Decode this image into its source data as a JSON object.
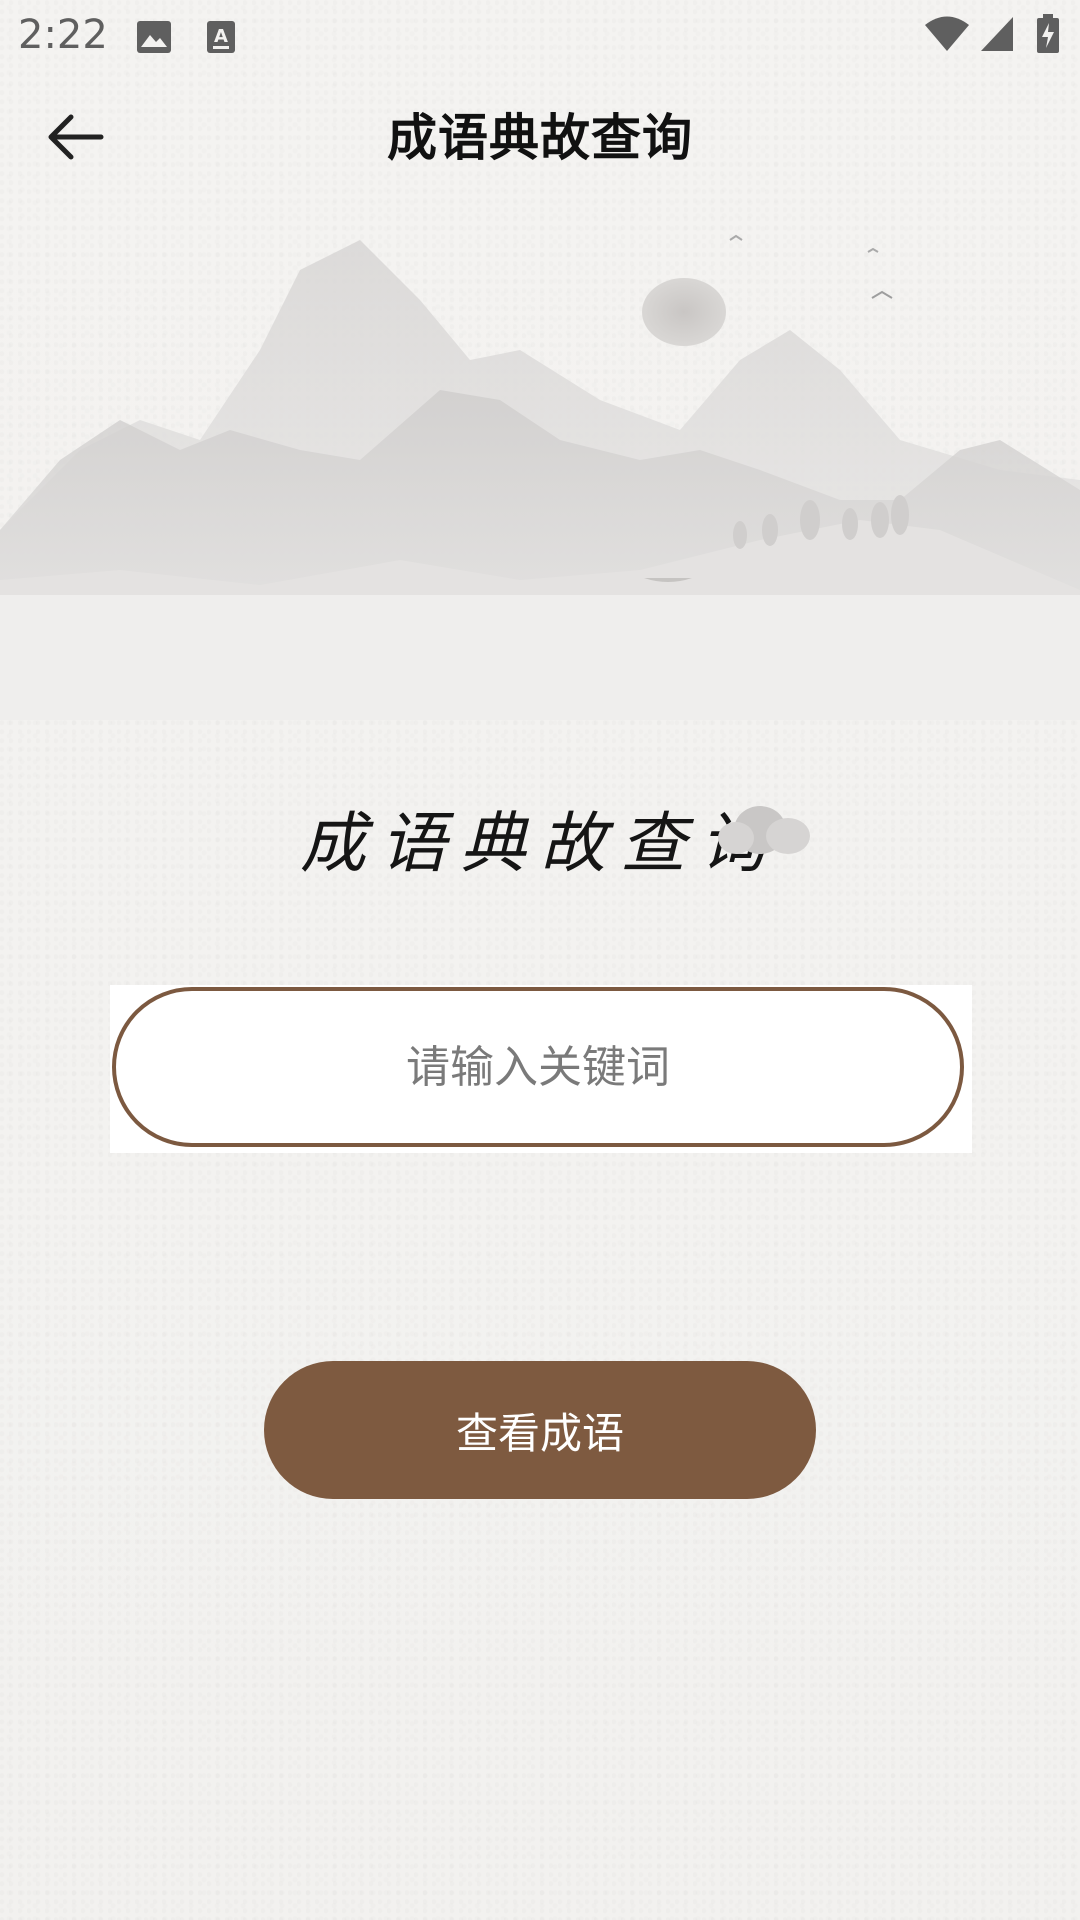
{
  "status_bar": {
    "time": "2:22",
    "icons": [
      "image-icon",
      "text-a-icon",
      "wifi-icon",
      "signal-icon",
      "battery-charging-icon"
    ]
  },
  "app_bar": {
    "back_icon": "arrow-left-icon",
    "title": "成语典故查询"
  },
  "hero": {
    "heading": "成语典故查询"
  },
  "search": {
    "placeholder": "请输入关键词",
    "value": ""
  },
  "action": {
    "label": "查看成语"
  },
  "colors": {
    "accent": "#7e5a40",
    "background": "#f3f2f0",
    "field_border": "#7c5940"
  }
}
